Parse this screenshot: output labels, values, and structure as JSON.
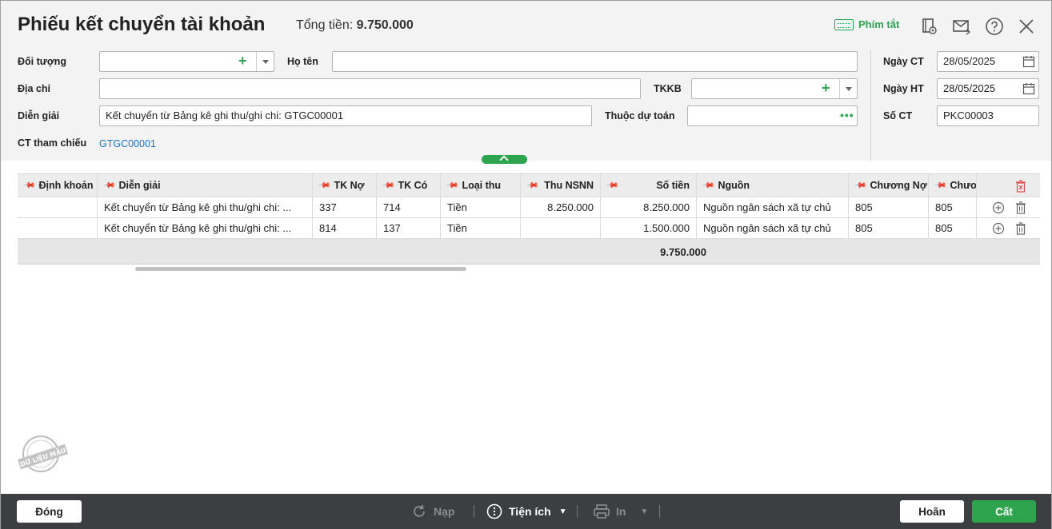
{
  "header": {
    "title": "Phiếu kết chuyển tài khoản",
    "total_label": "Tổng tiền:",
    "total_value": "9.750.000",
    "shortcut_label": "Phím tắt",
    "icons": [
      "keyboard-icon",
      "preview-icon",
      "email-icon",
      "help-icon",
      "close-icon"
    ]
  },
  "form": {
    "doi_tuong": {
      "label": "Đối tượng",
      "value": ""
    },
    "ho_ten": {
      "label": "Họ tên",
      "value": ""
    },
    "dia_chi": {
      "label": "Địa chỉ",
      "value": ""
    },
    "tkkb": {
      "label": "TKKB",
      "value": ""
    },
    "dien_giai": {
      "label": "Diễn giải",
      "value": "Kết chuyển từ Bảng kê ghi thu/ghi chi: GTGC00001"
    },
    "thuoc_du_toan": {
      "label": "Thuộc dự toán",
      "value": ""
    },
    "ct_tham_chieu": {
      "label": "CT tham chiếu",
      "value": "GTGC00001"
    },
    "ngay_ct": {
      "label": "Ngày CT",
      "value": "28/05/2025"
    },
    "ngay_ht": {
      "label": "Ngày HT",
      "value": "28/05/2025"
    },
    "so_ct": {
      "label": "Số CT",
      "value": "PKC00003"
    }
  },
  "grid": {
    "columns": [
      "Định khoản",
      "Diễn giải",
      "TK Nợ",
      "TK Có",
      "Loại thu",
      "Thu NSNN",
      "Số tiền",
      "Nguồn",
      "Chương Nợ",
      "Chươn"
    ],
    "rows": [
      [
        "",
        "Kết chuyển từ Bảng kê ghi thu/ghi chi: ...",
        "337",
        "714",
        "Tiền",
        "8.250.000",
        "8.250.000",
        "Nguồn ngân sách xã tự chủ",
        "805",
        "805"
      ],
      [
        "",
        "Kết chuyển từ Bảng kê ghi thu/ghi chi: ...",
        "814",
        "137",
        "Tiền",
        "",
        "1.500.000",
        "Nguồn ngân sách xã tự chủ",
        "805",
        "805"
      ]
    ],
    "total": "9.750.000"
  },
  "watermark": "DỮ LIỆU MẪU",
  "footer": {
    "close": "Đóng",
    "reload": "Nạp",
    "utilities": "Tiện ích",
    "print": "In",
    "cancel": "Hoãn",
    "save": "Cất"
  },
  "colors": {
    "accent": "#2ea44f",
    "link": "#1a73c9",
    "footer_bg": "#3c3e42"
  }
}
